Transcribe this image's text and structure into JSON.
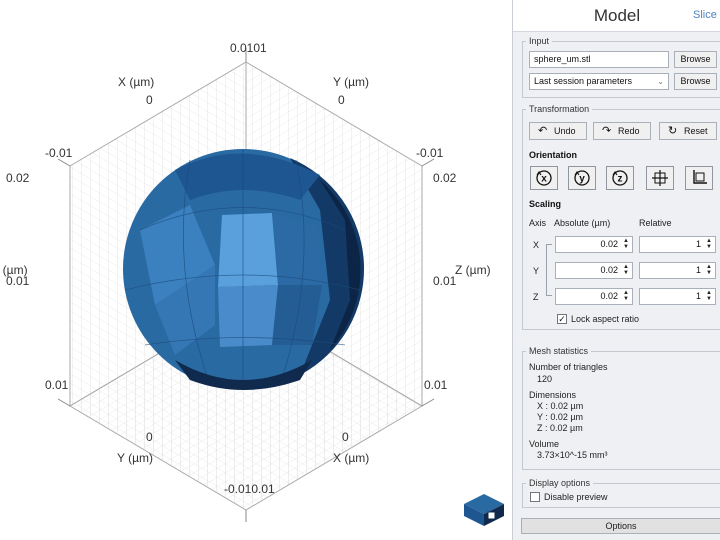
{
  "viewport": {
    "axis_labels": {
      "top": "0.0101",
      "x_top": "X (µm)",
      "x_top_zero": "0",
      "y_top": "Y (µm)",
      "y_top_zero": "0",
      "left_neg": "-0.01",
      "left_z_hi": "0.02",
      "z_left": "Z (µm)",
      "left_z_lo": "0.01",
      "left_bottom": "0.01",
      "right_neg": "-0.01",
      "right_z_hi": "0.02",
      "z_right": "Z (µm)",
      "right_z_lo": "0.01",
      "right_bottom": "0.01",
      "bottom_left_zero": "0",
      "y_bottom": "Y (µm)",
      "bottom_right_zero": "0",
      "x_bottom": "X (µm)",
      "bottom": "-0.010.01"
    },
    "colors": {
      "sphere_mid": "#2f6fa8",
      "sphere_dark": "#0f2a4d",
      "sphere_highlight": "#5aa0dc",
      "grid": "#d0d0d0"
    },
    "nav_cube_icon": "nav-cube-icon"
  },
  "panel": {
    "title": "Model",
    "slice_link": "Slice",
    "input": {
      "legend": "Input",
      "file_value": "sphere_um.stl",
      "browse_label": "Browse",
      "params_selected": "Last session parameters",
      "browse2_label": "Browse"
    },
    "transformation": {
      "legend": "Transformation",
      "undo_label": "Undo",
      "redo_label": "Redo",
      "reset_label": "Reset",
      "orientation_header": "Orientation",
      "orientation_icons": [
        "rotate-x-icon",
        "rotate-y-icon",
        "rotate-z-icon",
        "center-icon",
        "align-icon"
      ],
      "scaling_header": "Scaling",
      "col_axis": "Axis",
      "col_absolute": "Absolute (µm)",
      "col_relative": "Relative",
      "rows": [
        {
          "axis": "X",
          "absolute": "0.02",
          "relative": "1"
        },
        {
          "axis": "Y",
          "absolute": "0.02",
          "relative": "1"
        },
        {
          "axis": "Z",
          "absolute": "0.02",
          "relative": "1"
        }
      ],
      "lock_label": "Lock aspect ratio",
      "lock_checked": true
    },
    "mesh": {
      "legend": "Mesh statistics",
      "triangles_label": "Number of triangles",
      "triangles_value": "120",
      "dimensions_label": "Dimensions",
      "dim_x": "X : 0.02 µm",
      "dim_y": "Y : 0.02 µm",
      "dim_z": "Z : 0.02 µm",
      "volume_label": "Volume",
      "volume_value": "3.73×10^-15 mm³"
    },
    "display": {
      "legend": "Display options",
      "disable_preview_label": "Disable preview",
      "disable_preview_checked": false
    },
    "options_label": "Options"
  }
}
